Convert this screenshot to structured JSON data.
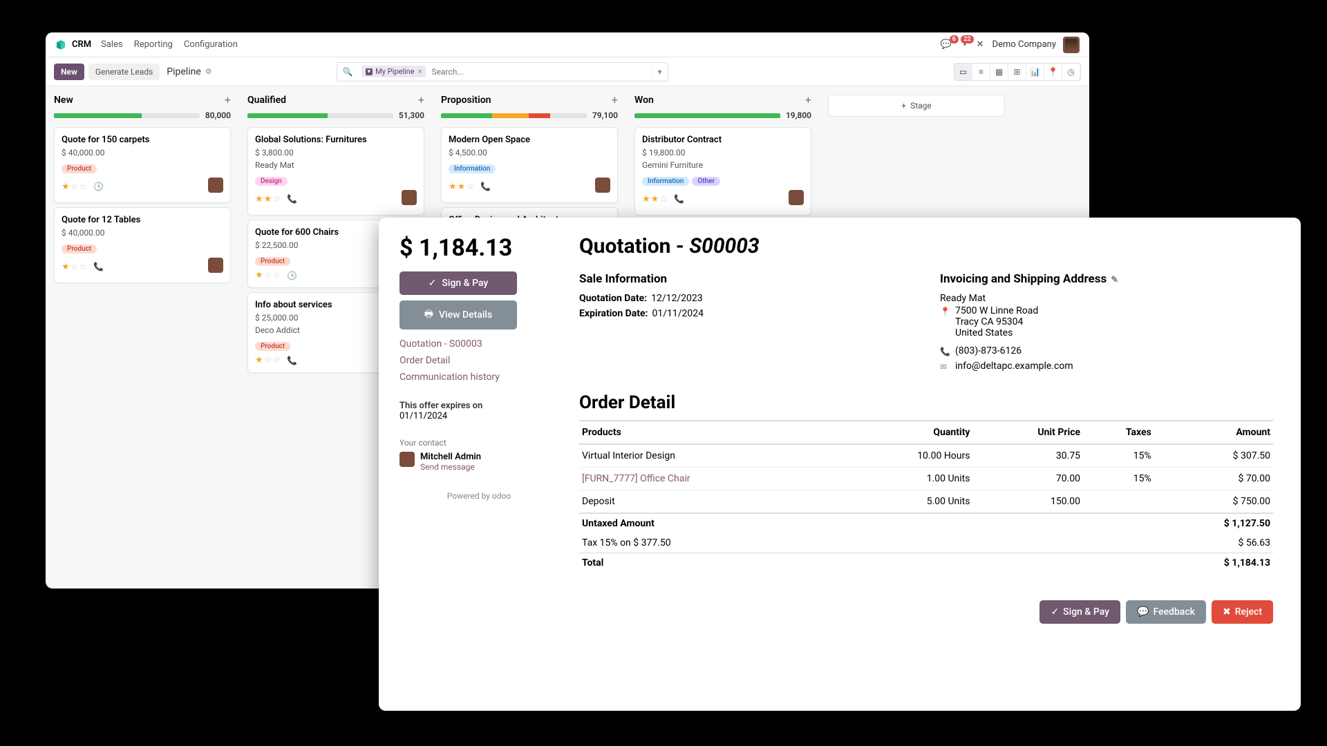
{
  "nav": {
    "brand": "CRM",
    "menus": [
      "Sales",
      "Reporting",
      "Configuration"
    ],
    "msg_badge": "6",
    "act_badge": "22",
    "company": "Demo Company"
  },
  "controls": {
    "new_btn": "New",
    "gen_leads": "Generate Leads",
    "breadcrumb": "Pipeline",
    "chip_label": "My Pipeline",
    "search_placeholder": "Search...",
    "stage_btn": "Stage"
  },
  "columns": [
    {
      "title": "New",
      "total": "80,000",
      "segs": [
        {
          "cls": "seg-green",
          "w": "60%"
        }
      ],
      "cards": [
        {
          "title": "Quote for 150 carpets",
          "amount": "$ 40,000.00",
          "tags": [
            {
              "cls": "tag-product",
              "t": "Product"
            }
          ],
          "stars": 1,
          "extra": "clock",
          "avatar": true
        },
        {
          "title": "Quote for 12 Tables",
          "amount": "$ 40,000.00",
          "tags": [
            {
              "cls": "tag-product",
              "t": "Product"
            }
          ],
          "stars": 1,
          "extra": "phone",
          "avatar": true
        }
      ]
    },
    {
      "title": "Qualified",
      "total": "51,300",
      "segs": [
        {
          "cls": "seg-green",
          "w": "55%"
        }
      ],
      "cards": [
        {
          "title": "Global Solutions: Furnitures",
          "amount": "$ 3,800.00",
          "subtitle": "Ready Mat",
          "tags": [
            {
              "cls": "tag-design",
              "t": "Design"
            }
          ],
          "stars": 2,
          "extra": "phone",
          "avatar": true
        },
        {
          "title": "Quote for 600 Chairs",
          "amount": "$ 22,500.00",
          "tags": [
            {
              "cls": "tag-product",
              "t": "Product"
            }
          ],
          "stars": 1,
          "extra": "clock",
          "avatar": false
        },
        {
          "title": "Info about services",
          "amount": "$ 25,000.00",
          "subtitle": "Deco Addict",
          "tags": [
            {
              "cls": "tag-product",
              "t": "Product"
            }
          ],
          "stars": 1,
          "extra": "phone",
          "avatar": false
        }
      ]
    },
    {
      "title": "Proposition",
      "total": "79,100",
      "segs": [
        {
          "cls": "seg-green",
          "w": "35%"
        },
        {
          "cls": "seg-orange",
          "w": "25%"
        },
        {
          "cls": "seg-red",
          "w": "15%"
        }
      ],
      "cards": [
        {
          "title": "Modern Open Space",
          "amount": "$ 4,500.00",
          "tags": [
            {
              "cls": "tag-info",
              "t": "Information"
            }
          ],
          "stars": 2,
          "extra": "phone",
          "avatar": true
        },
        {
          "title": "Office Design and Architecture",
          "amount": "",
          "tags": [],
          "stars": 0,
          "extra": "",
          "avatar": false
        }
      ]
    },
    {
      "title": "Won",
      "total": "19,800",
      "segs": [
        {
          "cls": "seg-green",
          "w": "100%"
        }
      ],
      "cards": [
        {
          "title": "Distributor Contract",
          "amount": "$ 19,800.00",
          "subtitle": "Gemini Furniture",
          "tags": [
            {
              "cls": "tag-info",
              "t": "Information"
            },
            {
              "cls": "tag-other",
              "t": "Other"
            }
          ],
          "stars": 2,
          "extra": "phone",
          "avatar": true
        }
      ]
    }
  ],
  "quote": {
    "price": "$ 1,184.13",
    "sign_pay": "Sign & Pay",
    "view_details": "View Details",
    "links": [
      "Quotation - S00003",
      "Order Detail",
      "Communication history"
    ],
    "expires_label": "This offer expires on",
    "expires_date": "01/11/2024",
    "contact_label": "Your contact",
    "contact_name": "Mitchell Admin",
    "send_msg": "Send message",
    "powered": "Powered by odoo",
    "title_pre": "Quotation - ",
    "title_id": "S00003",
    "sale_info": "Sale Information",
    "q_date_l": "Quotation Date:",
    "q_date_v": "12/12/2023",
    "e_date_l": "Expiration Date:",
    "e_date_v": "01/11/2024",
    "inv_title": "Invoicing and Shipping Address",
    "addr_name": "Ready Mat",
    "addr1": "7500 W Linne Road",
    "addr2": "Tracy CA 95304",
    "addr3": "United States",
    "phone": "(803)-873-6126",
    "email": "info@deltapc.example.com",
    "order_title": "Order Detail",
    "headers": {
      "p": "Products",
      "q": "Quantity",
      "u": "Unit Price",
      "t": "Taxes",
      "a": "Amount"
    },
    "lines": [
      {
        "p": "Virtual Interior Design",
        "q": "10.00 Hours",
        "u": "30.75",
        "t": "15%",
        "a": "$ 307.50",
        "link": false
      },
      {
        "p": "[FURN_7777] Office Chair",
        "q": "1.00 Units",
        "u": "70.00",
        "t": "15%",
        "a": "$ 70.00",
        "link": true
      },
      {
        "p": "Deposit",
        "q": "5.00 Units",
        "u": "150.00",
        "t": "",
        "a": "$ 750.00",
        "link": false
      }
    ],
    "totals": [
      {
        "l": "Untaxed Amount",
        "v": "$ 1,127.50",
        "bold": true
      },
      {
        "l": "Tax 15% on $ 377.50",
        "v": "$ 56.63",
        "bold": false
      },
      {
        "l": "Total",
        "v": "$ 1,184.13",
        "bold": true
      }
    ],
    "actions": {
      "sign": "Sign & Pay",
      "feedback": "Feedback",
      "reject": "Reject"
    }
  }
}
